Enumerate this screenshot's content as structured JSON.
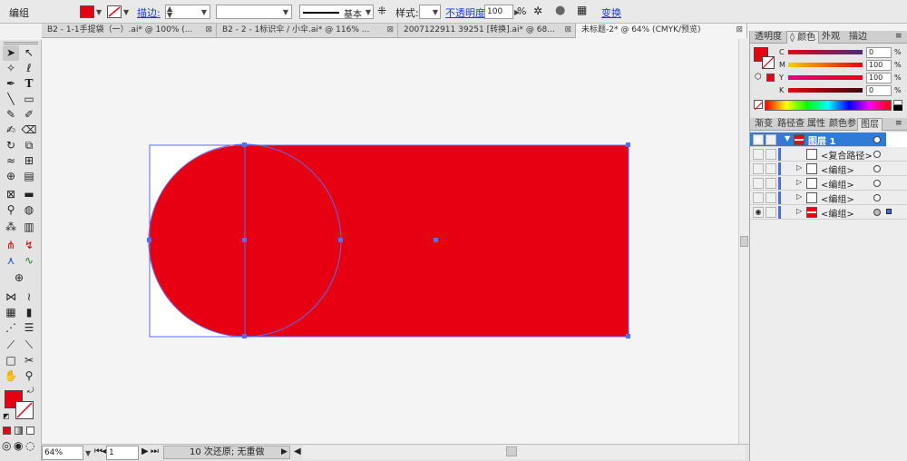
{
  "control_bar": {
    "selection_label": "编组",
    "fill_color": "#e60012",
    "stroke_label": "描边:",
    "stroke_style_label": "基本",
    "style_label": "样式:",
    "opacity_label": "不透明度:",
    "opacity_value": "100",
    "opacity_unit": "%",
    "transform_label": "变换"
  },
  "tabs": [
    {
      "label": "B2 - 1-1手提袋（一）.ai* @ 100% (..."
    },
    {
      "label": "B2 - 2 - 1标识伞 / 小伞.ai* @ 116% ..."
    },
    {
      "label": "2007122911 39251 [转换].ai* @ 68..."
    },
    {
      "label": "未标题-2* @ 64% (CMYK/预览)"
    }
  ],
  "canvas": {
    "shape_fill": "#e60012",
    "selection_color": "#5a6cf0"
  },
  "status": {
    "zoom": "64%",
    "page": "1",
    "history": "10 次还原; 无重做"
  },
  "color_panel": {
    "tabs": [
      "透明度",
      "颜色",
      "外观",
      "描边"
    ],
    "active_tab": "颜色",
    "channels": [
      {
        "name": "C",
        "value": "0"
      },
      {
        "name": "M",
        "value": "100"
      },
      {
        "name": "Y",
        "value": "100"
      },
      {
        "name": "K",
        "value": "0"
      }
    ],
    "fill_color": "#e60012"
  },
  "layers_panel": {
    "tabs": [
      "渐变",
      "路径查",
      "属性",
      "颜色参",
      "图层"
    ],
    "active_tab": "图层",
    "layers": [
      {
        "name": "图层 1",
        "selected": true,
        "visible": true,
        "expandable": true
      },
      {
        "name": "<复合路径>",
        "selected": false,
        "visible": false,
        "expandable": false
      },
      {
        "name": "<编组>",
        "selected": false,
        "visible": false,
        "expandable": true
      },
      {
        "name": "<编组>",
        "selected": false,
        "visible": false,
        "expandable": true
      },
      {
        "name": "<编组>",
        "selected": false,
        "visible": false,
        "expandable": true
      },
      {
        "name": "<编组>",
        "selected": false,
        "visible": true,
        "expandable": true
      }
    ]
  }
}
